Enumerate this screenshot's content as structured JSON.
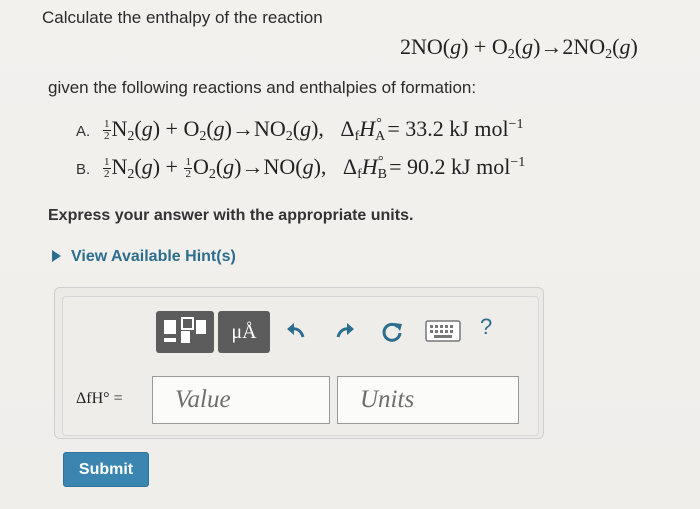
{
  "question": {
    "intro": "Calculate the enthalpy of the reaction",
    "main_reaction": "2NO(g) + O2(g)→2NO2(g)",
    "given": "given the following reactions and enthalpies of formation:",
    "reactions": [
      {
        "label": "A.",
        "equation": "1/2 N2(g) + O2(g)→NO2(g),",
        "enthalpy": "ΔfH°A = 33.2 kJ mol−1"
      },
      {
        "label": "B.",
        "equation": "1/2 N2(g) + 1/2 O2(g)→NO(g),",
        "enthalpy": "ΔfH°B = 90.2 kJ mol−1"
      }
    ],
    "express": "Express your answer with the appropriate units.",
    "hint_link": "View Available Hint(s)"
  },
  "toolbar": {
    "units_button": "μÅ",
    "help": "?",
    "icons": [
      "templates-icon",
      "units-icon",
      "undo-icon",
      "redo-icon",
      "reset-icon",
      "keyboard-icon",
      "help-icon"
    ]
  },
  "answer": {
    "variable_label": "ΔfH° =",
    "value_placeholder": "Value",
    "units_placeholder": "Units"
  },
  "submit_label": "Submit",
  "colors": {
    "link": "#2d6d8e",
    "toolbar_button": "#5c5c5c",
    "submit": "#3a86b0"
  }
}
